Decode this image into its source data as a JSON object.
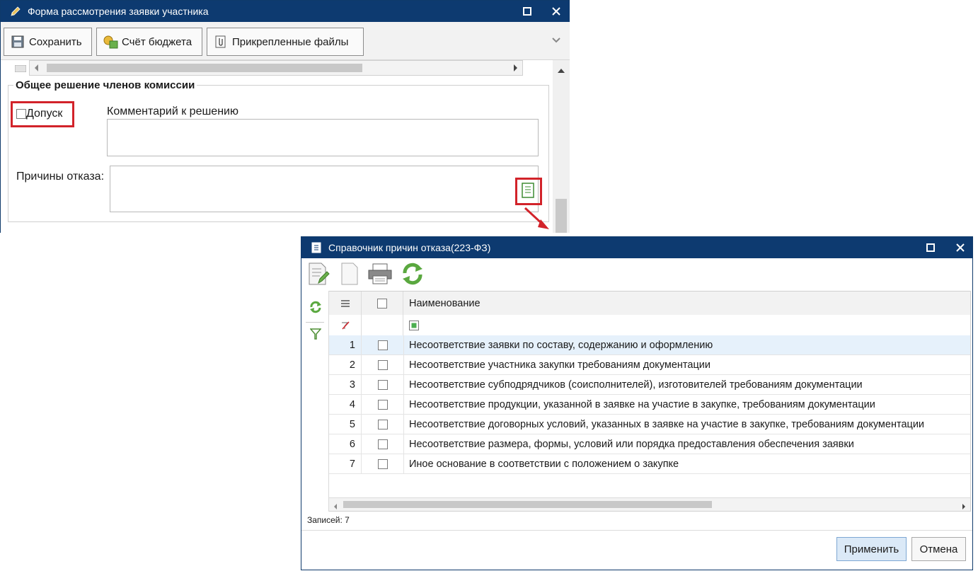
{
  "window1": {
    "title": "Форма рассмотрения заявки участника",
    "toolbar": {
      "save_label": "Сохранить",
      "budget_label": "Счёт бюджета",
      "files_label": "Прикрепленные файлы"
    },
    "group_title": "Общее решение членов комиссии",
    "admit_label": "Допуск",
    "comment_label": "Комментарий к решению",
    "comment_value": "",
    "reasons_label": "Причины отказа:",
    "reasons_value": ""
  },
  "window2": {
    "title": "Справочник причин отказа(223-ФЗ)",
    "column_name": "Наименование",
    "rows": [
      {
        "n": "1",
        "name": "Несоответствие заявки по составу, содержанию и оформлению"
      },
      {
        "n": "2",
        "name": "Несоответствие участника закупки требованиям документации"
      },
      {
        "n": "3",
        "name": "Несоответствие субподрядчиков (соисполнителей), изготовителей требованиям документации"
      },
      {
        "n": "4",
        "name": "Несоответствие продукции, указанной в заявке на участие в закупке, требованиям документации"
      },
      {
        "n": "5",
        "name": "Несоответствие договорных условий, указанных в заявке на участие в закупке, требованиям документации"
      },
      {
        "n": "6",
        "name": "Несоответствие размера, формы, условий или порядка предоставления обеспечения заявки"
      },
      {
        "n": "7",
        "name": "Иное основание в соответствии с положением о закупке"
      }
    ],
    "records_label": "Записей: 7",
    "apply_label": "Применить",
    "cancel_label": "Отмена"
  },
  "colors": {
    "titlebar": "#0d3a70",
    "highlight": "#d2232a",
    "selected_row": "#e6f1fb",
    "icon_green": "#4caf50"
  }
}
